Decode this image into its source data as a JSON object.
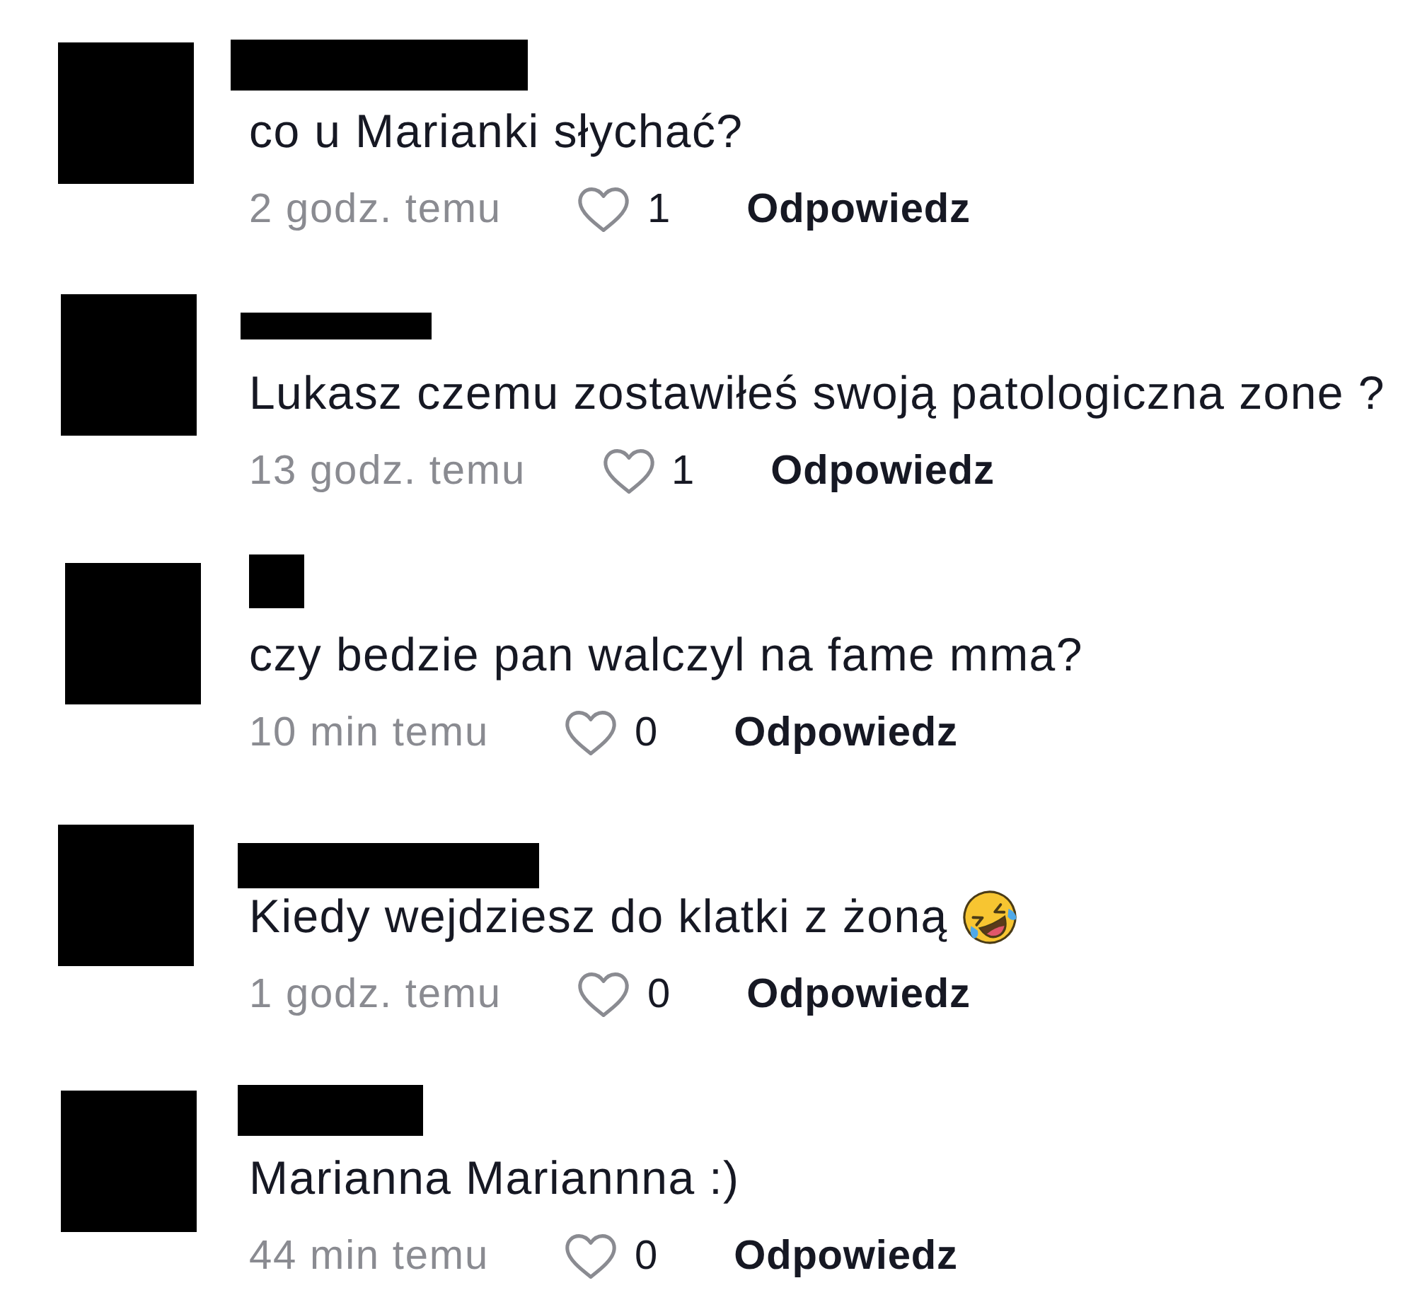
{
  "comments": [
    {
      "text": "co u Marianki słychać?",
      "emoji": false,
      "time": "2 godz. temu",
      "likes": "1",
      "reply": "Odpowiedz"
    },
    {
      "text": "Lukasz czemu zostawiłeś swoją patologiczna zone ?",
      "emoji": false,
      "time": "13 godz. temu",
      "likes": "1",
      "reply": "Odpowiedz"
    },
    {
      "text": "czy bedzie pan walczyl na fame mma?",
      "emoji": false,
      "time": "10 min temu",
      "likes": "0",
      "reply": "Odpowiedz"
    },
    {
      "text": "Kiedy wejdziesz do klatki z żoną",
      "emoji": true,
      "time": "1 godz. temu",
      "likes": "0",
      "reply": "Odpowiedz"
    },
    {
      "text": "Marianna Mariannna :)",
      "emoji": false,
      "time": "44 min temu",
      "likes": "0",
      "reply": "Odpowiedz"
    }
  ]
}
